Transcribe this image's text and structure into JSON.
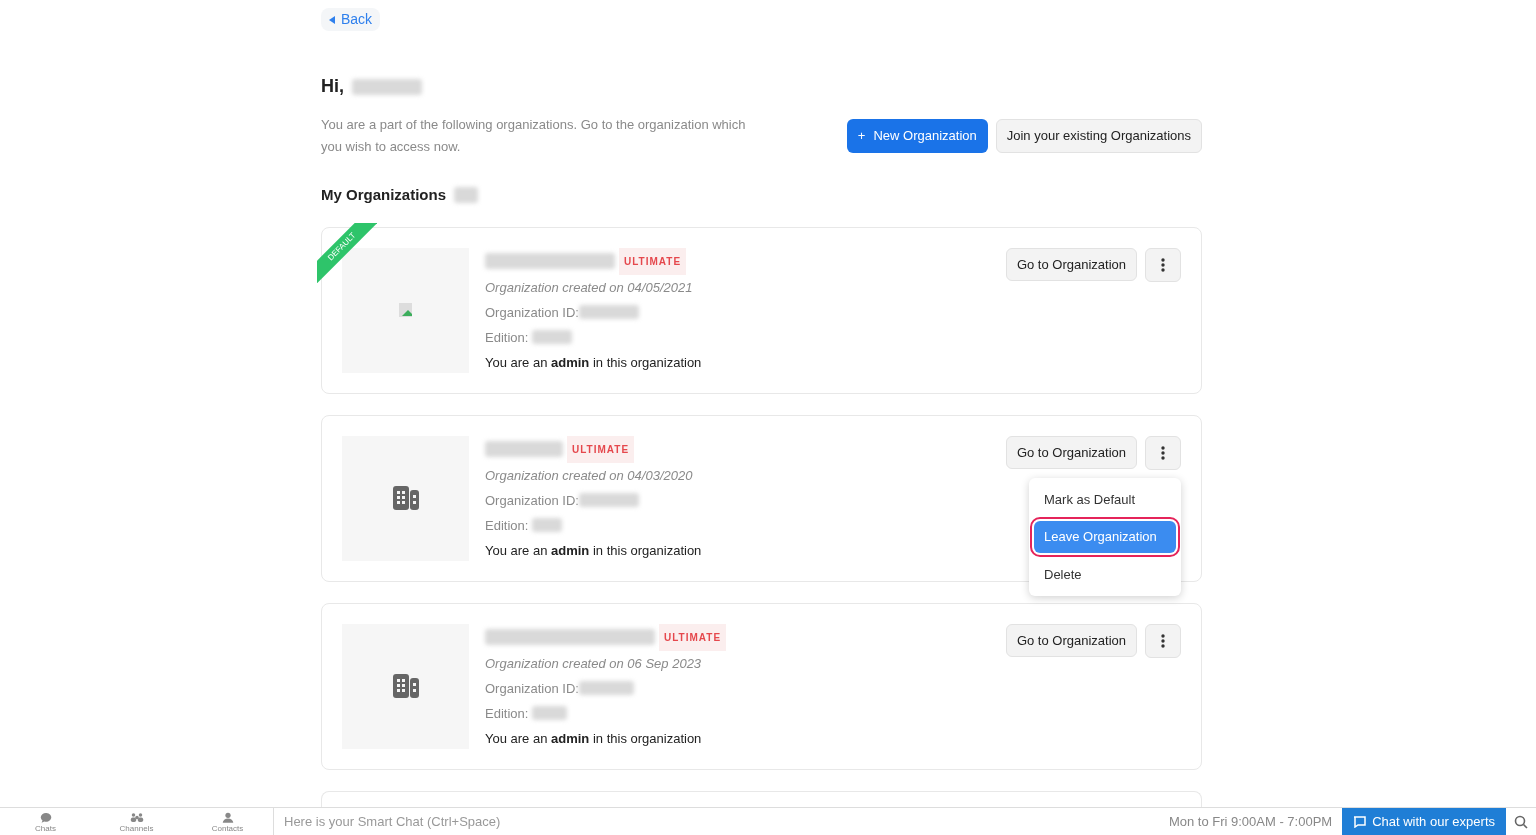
{
  "back": {
    "label": "Back"
  },
  "greeting": "Hi,",
  "intro": "You are a part of the following organizations. Go to the organization which you wish to access now.",
  "actions": [
    {
      "kind": "primary",
      "icon": "+",
      "label": "New Organization"
    },
    {
      "kind": "secondary",
      "label": "Join your existing Organizations"
    }
  ],
  "section_title": "My Organizations",
  "organizations": [
    {
      "kind": "broken-image",
      "default": true,
      "ribbon": "DEFAULT",
      "edition_badge": "ULTIMATE",
      "created": "Organization created on 04/05/2021",
      "id_label": "Organization ID:",
      "edition_label": "Edition:",
      "role": "You are an **admin** in this organization",
      "go_button": "Go to Organization"
    },
    {
      "kind": "building",
      "default": false,
      "edition_badge": "ULTIMATE",
      "created": "Organization created on 04/03/2020",
      "id_label": "Organization ID:",
      "edition_label": "Edition:",
      "role": "You are an **admin** in this organization",
      "go_button": "Go to Organization",
      "menu": [
        {
          "label": "Mark as Default",
          "selected": false
        },
        {
          "label": "Leave Organization",
          "selected": true
        },
        {
          "label": "Delete",
          "selected": false
        }
      ]
    },
    {
      "kind": "building",
      "default": false,
      "edition_badge": "ULTIMATE",
      "created": "Organization created on 06 Sep 2023",
      "id_label": "Organization ID:",
      "edition_label": "Edition:",
      "role": "You are an **admin** in this organization",
      "go_button": "Go to Organization"
    }
  ],
  "more_cards_below": true,
  "bottom_bar": {
    "nav": [
      {
        "kind": "chats",
        "label": "Chats"
      },
      {
        "kind": "channels",
        "label": "Channels"
      },
      {
        "kind": "contacts",
        "label": "Contacts"
      }
    ],
    "smart_chat_placeholder": "Here is your Smart Chat (Ctrl+Space)",
    "hours": "Mon to Fri 9:00AM - 7:00PM",
    "chat_button": "Chat with our experts"
  }
}
